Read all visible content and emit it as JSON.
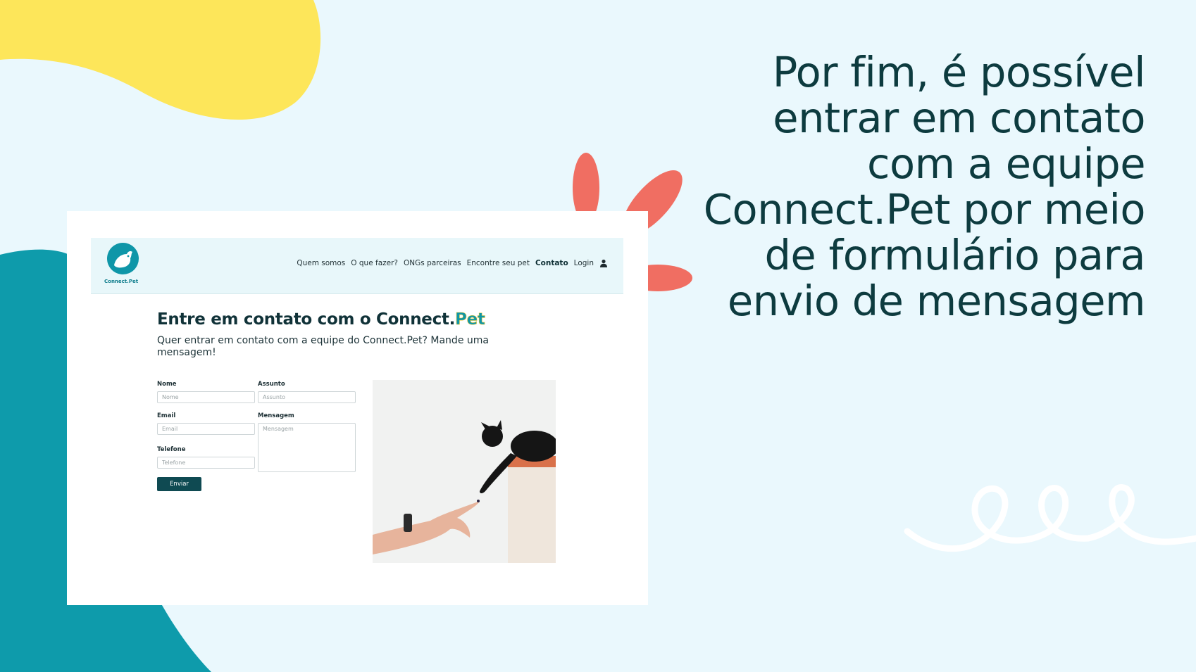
{
  "slide": {
    "text": "Por fim, é possível entrar em contato com a equipe Connect.Pet por meio de formulário para envio de mensagem"
  },
  "site": {
    "logo_text": "Connect.Pet",
    "nav": {
      "items": [
        "Quem somos",
        "O que fazer?",
        "ONGs parceiras",
        "Encontre seu pet",
        "Contato",
        "Login"
      ],
      "active": "Contato"
    },
    "title_prefix": "Entre em contato com o Connect.",
    "title_highlight": "Pet",
    "subtitle": "Quer entrar em contato com a equipe do Connect.Pet? Mande uma mensagem!",
    "form": {
      "nome_label": "Nome",
      "nome_placeholder": "Nome",
      "assunto_label": "Assunto",
      "assunto_placeholder": "Assunto",
      "email_label": "Email",
      "email_placeholder": "Email",
      "mensagem_label": "Mensagem",
      "mensagem_placeholder": "Mensagem",
      "telefone_label": "Telefone",
      "telefone_placeholder": "Telefone",
      "submit_label": "Enviar"
    }
  },
  "colors": {
    "background": "#eaf8fd",
    "yellow_blob": "#fde65a",
    "teal_blob": "#0e9bab",
    "coral": "#f06e62",
    "dark_text": "#0d3b3f",
    "button": "#0f4a52"
  },
  "icons": {
    "user": "user-icon",
    "logo": "dog-logo-icon"
  }
}
